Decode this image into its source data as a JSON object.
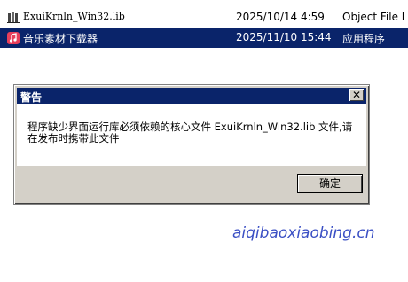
{
  "files": [
    {
      "icon": "library-file-icon",
      "name": "ExuiKrnln_Win32.lib",
      "date": "2025/10/14 4:59",
      "type": "Object File L"
    },
    {
      "icon": "music-app-icon",
      "name": "音乐素材下载器",
      "date": "2025/11/10 15:44",
      "type": "应用程序"
    }
  ],
  "dialog": {
    "title": "警告",
    "close_glyph": "✕",
    "message": "程序缺少界面运行库必须依赖的核心文件 ExuiKrnln_Win32.lib 文件,请在发布时携带此文件",
    "ok_label": "确定"
  },
  "watermark": "aiqibaoxiaobing.cn",
  "colors": {
    "selection": "#0a246a",
    "dialog_face": "#d4d0c8",
    "watermark": "#3a4fc4"
  }
}
